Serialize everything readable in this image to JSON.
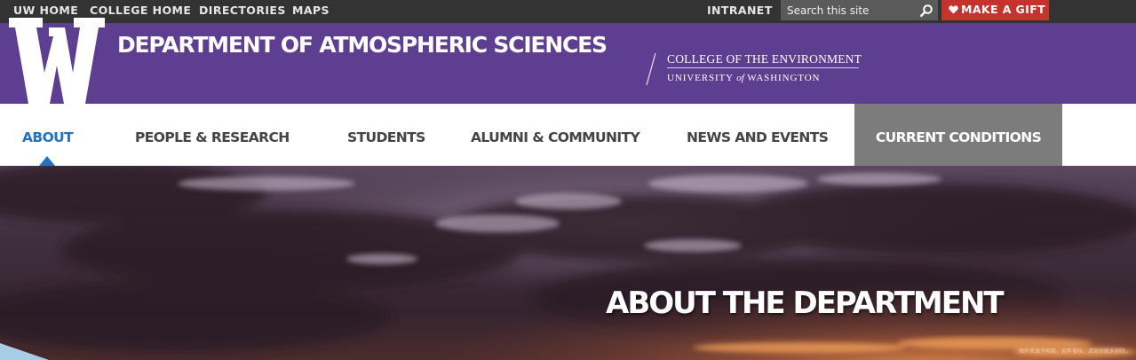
{
  "top_nav": {
    "links": [
      "UW HOME",
      "COLLEGE HOME",
      "DIRECTORIES",
      "MAPS"
    ],
    "intranet": "INTRANET",
    "search_placeholder": "Search this site",
    "search_icon": "magnifier-icon",
    "gift_label": "MAKE A GIFT",
    "gift_icon": "heart-icon"
  },
  "header": {
    "logo": "uw-w-logo",
    "department": "DEPARTMENT OF ATMOSPHERIC SCIENCES",
    "college": "COLLEGE OF THE ENVIRONMENT",
    "university_pre": "UNIVERSITY",
    "university_of": "of",
    "university_post": "WASHINGTON"
  },
  "main_nav": {
    "items": [
      "ABOUT",
      "PEOPLE & RESEARCH",
      "STUDENTS",
      "ALUMNI & COMMUNITY",
      "NEWS AND EVENTS",
      "CURRENT CONDITIONS"
    ],
    "active": "ABOUT"
  },
  "hero": {
    "title": "ABOUT THE DEPARTMENT",
    "credit": "图片来源于网络，如有侵权，请及时联系删除。"
  },
  "colors": {
    "topbar": "#333333",
    "purple": "#5d3e91",
    "gift": "#c5332c",
    "active": "#1f73c2",
    "current_conditions": "#7c7c7c"
  }
}
